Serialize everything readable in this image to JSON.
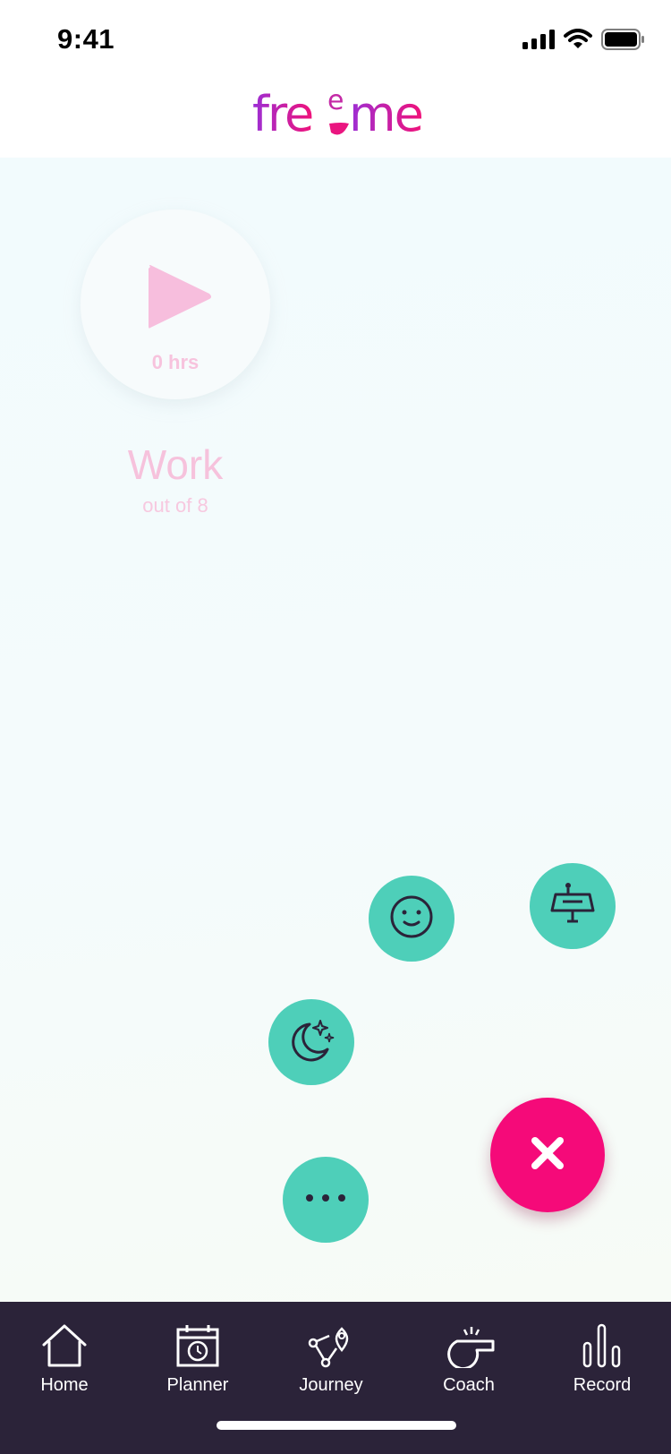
{
  "status_bar": {
    "time": "9:41",
    "icons": [
      "cellular-signal-icon",
      "wifi-icon",
      "battery-icon"
    ]
  },
  "header": {
    "logo_text": "freeme",
    "logo_color_start": "#9b2fd6",
    "logo_color_end": "#f0127a"
  },
  "work_card": {
    "hours": "0 hrs",
    "title": "Work",
    "subtitle": "out of 8",
    "accent_color": "#f7c3dd"
  },
  "quick_actions": [
    {
      "name": "mood-button",
      "icon": "smiley-face-icon"
    },
    {
      "name": "work-button",
      "icon": "desk-lamp-icon"
    },
    {
      "name": "sleep-button",
      "icon": "moon-stars-icon"
    },
    {
      "name": "more-button",
      "icon": "more-dots-icon"
    }
  ],
  "quick_action_color": "#4ecfb9",
  "close_button": {
    "icon": "close-icon",
    "color": "#f50a79"
  },
  "tabbar": {
    "background": "#2b2339",
    "items": [
      {
        "label": "Home",
        "icon": "home-icon"
      },
      {
        "label": "Planner",
        "icon": "calendar-clock-icon"
      },
      {
        "label": "Journey",
        "icon": "journey-route-icon"
      },
      {
        "label": "Coach",
        "icon": "whistle-icon"
      },
      {
        "label": "Record",
        "icon": "bar-chart-icon"
      }
    ]
  }
}
